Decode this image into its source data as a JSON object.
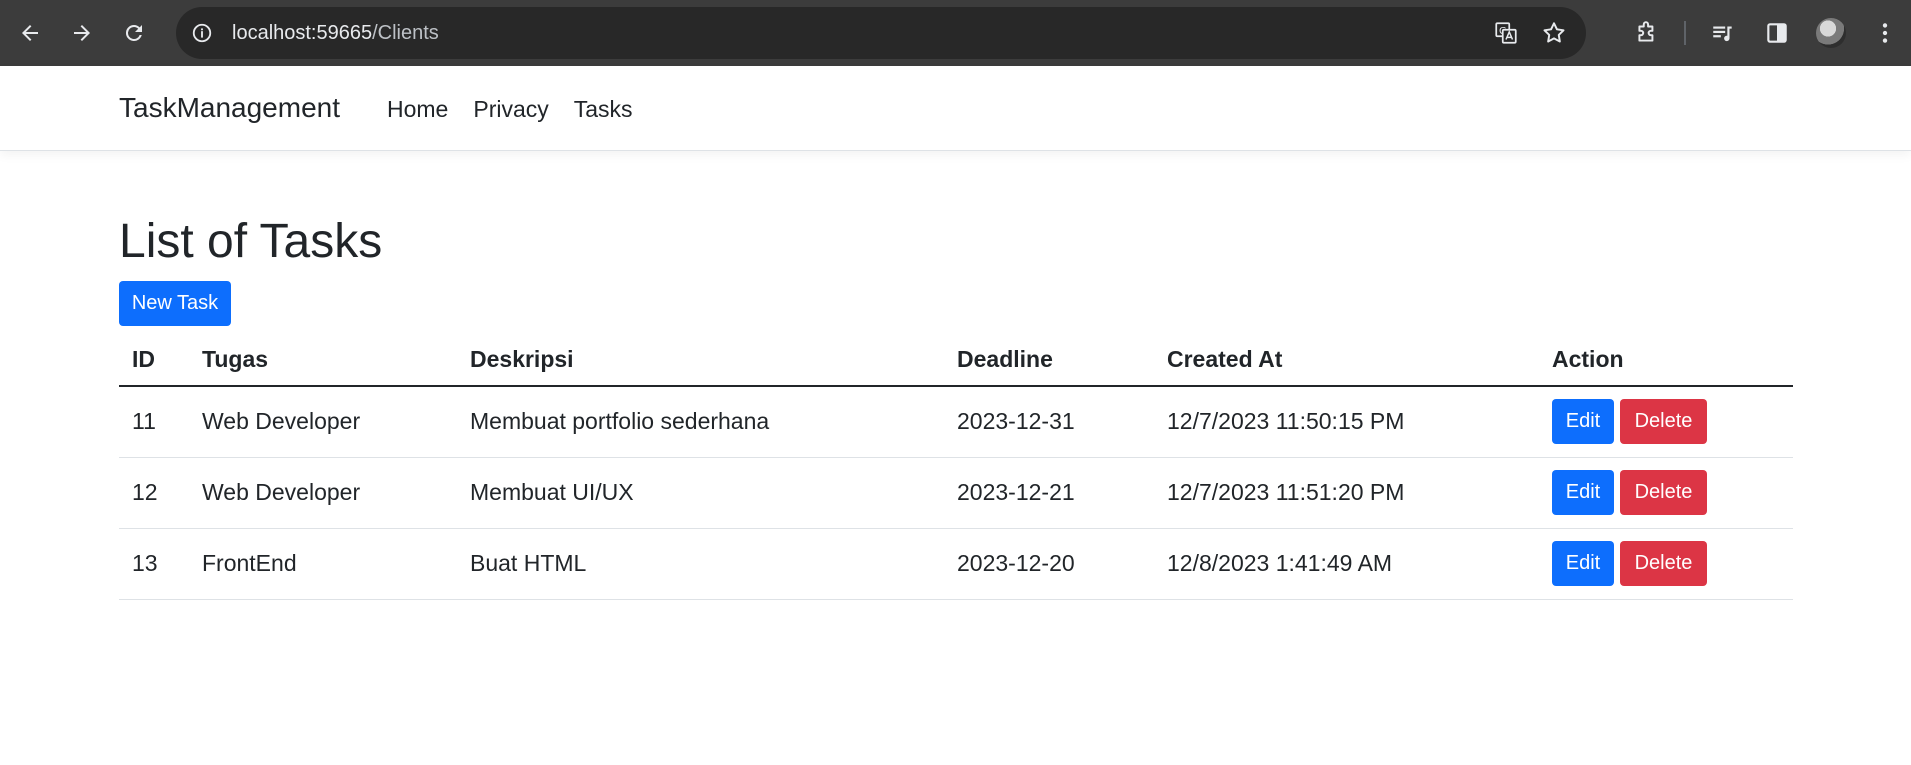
{
  "browser": {
    "url_host": "localhost:59665",
    "url_path": "/Clients"
  },
  "navbar": {
    "brand": "TaskManagement",
    "links": [
      "Home",
      "Privacy",
      "Tasks"
    ]
  },
  "page": {
    "title": "List of Tasks",
    "new_task_label": "New Task"
  },
  "table": {
    "headers": [
      "ID",
      "Tugas",
      "Deskripsi",
      "Deadline",
      "Created At",
      "Action"
    ],
    "rows": [
      {
        "id": "11",
        "tugas": "Web Developer",
        "deskripsi": "Membuat portfolio sederhana",
        "deadline": "2023-12-31",
        "created_at": "12/7/2023 11:50:15 PM"
      },
      {
        "id": "12",
        "tugas": "Web Developer",
        "deskripsi": "Membuat UI/UX",
        "deadline": "2023-12-21",
        "created_at": "12/7/2023 11:51:20 PM"
      },
      {
        "id": "13",
        "tugas": "FrontEnd",
        "deskripsi": "Buat HTML",
        "deadline": "2023-12-20",
        "created_at": "12/8/2023 1:41:49 AM"
      }
    ],
    "edit_label": "Edit",
    "delete_label": "Delete"
  },
  "colors": {
    "primary": "#0d6efd",
    "danger": "#dc3545",
    "chrome_bg": "#3c3c3c",
    "omnibox_bg": "#282828"
  },
  "icons": {
    "back": "arrow-left-icon",
    "forward": "arrow-right-icon",
    "reload": "reload-icon",
    "site_info": "info-icon",
    "translate": "translate-icon",
    "bookmark": "star-icon",
    "extensions": "puzzle-icon",
    "media": "media-queue-icon",
    "side_panel": "side-panel-icon",
    "menu": "kebab-menu-icon"
  }
}
